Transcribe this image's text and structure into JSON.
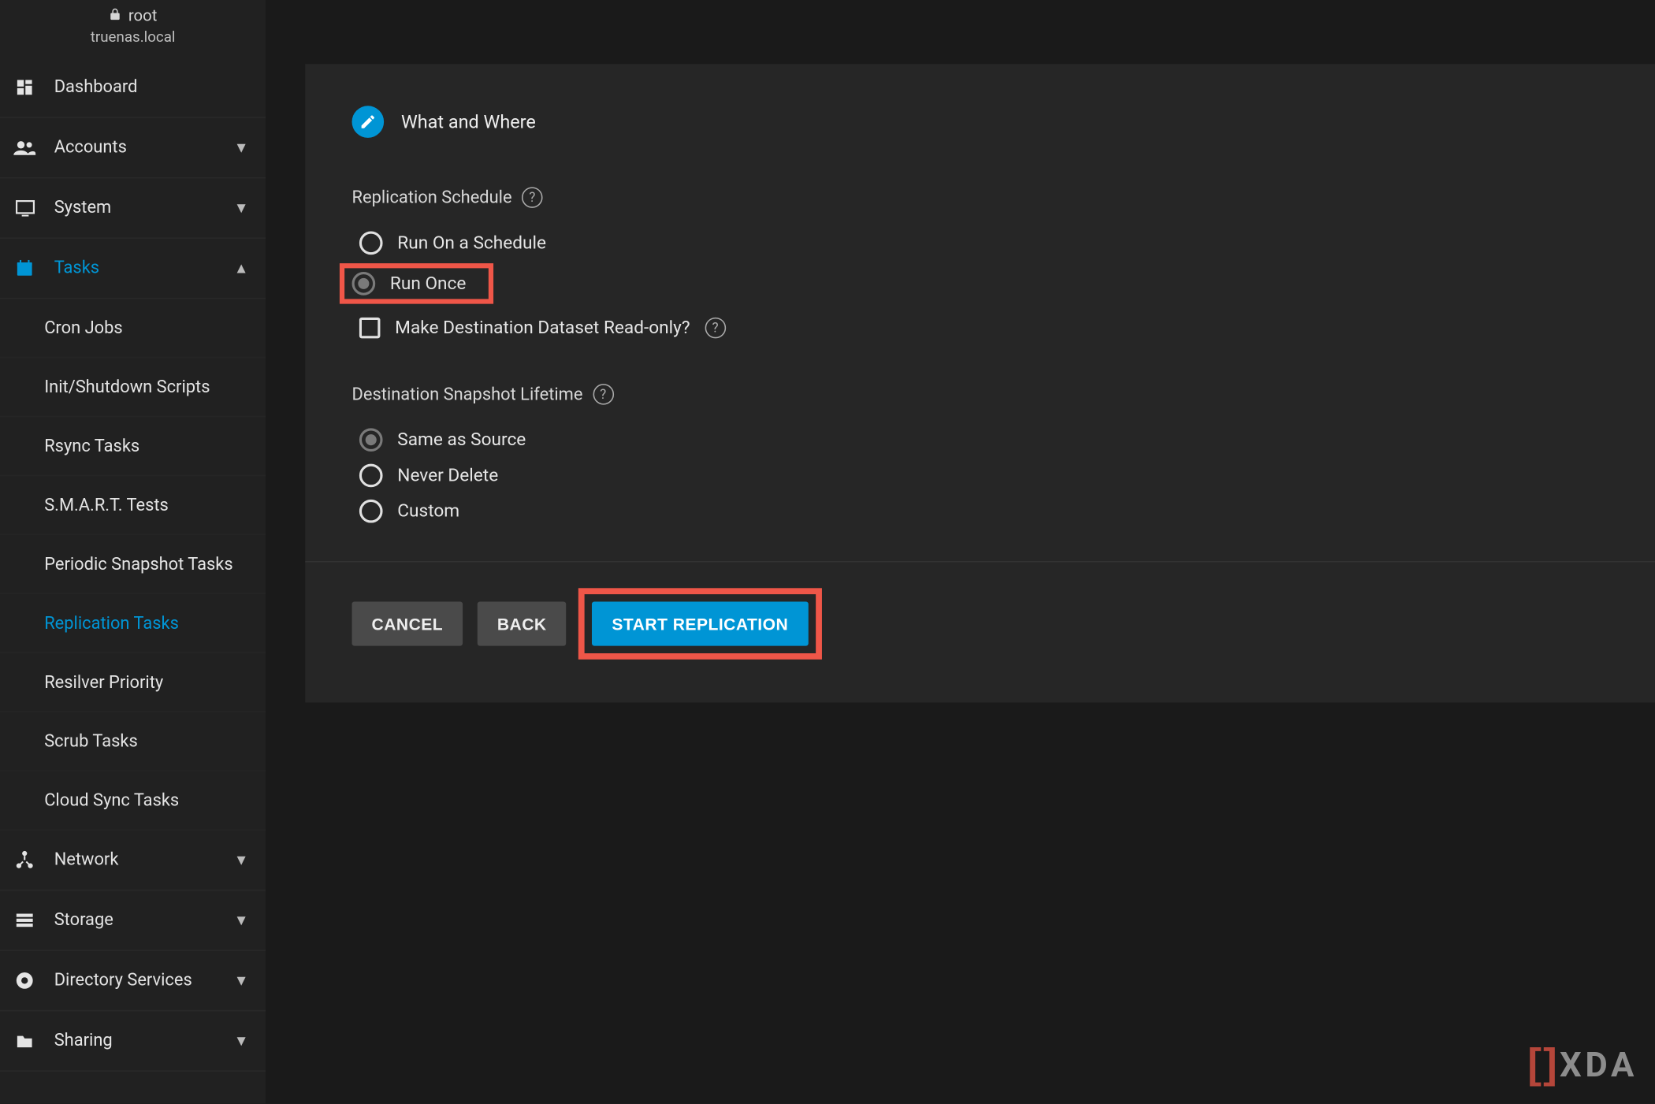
{
  "user": {
    "name": "root",
    "host": "truenas.local"
  },
  "sidebar": {
    "items": [
      {
        "icon": "dashboard",
        "label": "Dashboard",
        "expandable": false
      },
      {
        "icon": "accounts",
        "label": "Accounts",
        "expandable": true,
        "expanded": false
      },
      {
        "icon": "system",
        "label": "System",
        "expandable": true,
        "expanded": false
      },
      {
        "icon": "tasks",
        "label": "Tasks",
        "expandable": true,
        "expanded": true,
        "active": true,
        "children": [
          {
            "label": "Cron Jobs"
          },
          {
            "label": "Init/Shutdown Scripts"
          },
          {
            "label": "Rsync Tasks"
          },
          {
            "label": "S.M.A.R.T. Tests"
          },
          {
            "label": "Periodic Snapshot Tasks"
          },
          {
            "label": "Replication Tasks",
            "active": true
          },
          {
            "label": "Resilver Priority"
          },
          {
            "label": "Scrub Tasks"
          },
          {
            "label": "Cloud Sync Tasks"
          }
        ]
      },
      {
        "icon": "network",
        "label": "Network",
        "expandable": true,
        "expanded": false
      },
      {
        "icon": "storage",
        "label": "Storage",
        "expandable": true,
        "expanded": false
      },
      {
        "icon": "directory",
        "label": "Directory Services",
        "expandable": true,
        "expanded": false
      },
      {
        "icon": "sharing",
        "label": "Sharing",
        "expandable": true,
        "expanded": false
      }
    ]
  },
  "wizard": {
    "step_completed_label": "What and Where",
    "schedule": {
      "title": "Replication Schedule",
      "options": [
        {
          "label": "Run On a Schedule",
          "selected": false
        },
        {
          "label": "Run Once",
          "selected": true,
          "highlighted": true
        }
      ],
      "readonly_checkbox": {
        "label": "Make Destination Dataset Read-only?",
        "checked": false
      }
    },
    "lifetime": {
      "title": "Destination Snapshot Lifetime",
      "options": [
        {
          "label": "Same as Source",
          "selected": true
        },
        {
          "label": "Never Delete",
          "selected": false
        },
        {
          "label": "Custom",
          "selected": false
        }
      ]
    },
    "buttons": {
      "cancel": "CANCEL",
      "back": "BACK",
      "start": "START REPLICATION",
      "start_highlighted": true
    }
  },
  "watermark": "XDA",
  "colors": {
    "accent": "#0095d5",
    "highlight": "#ef5648",
    "panel": "#262626",
    "page": "#1a1a1a"
  }
}
